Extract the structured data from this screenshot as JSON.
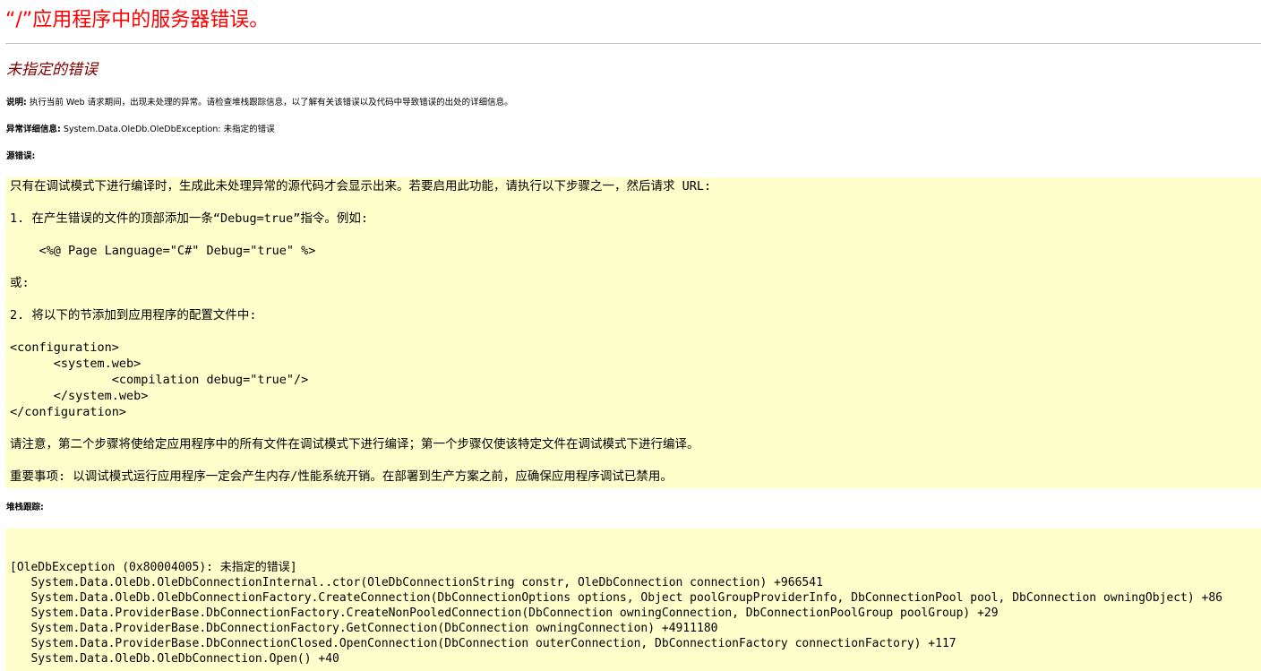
{
  "page": {
    "title": "“/”应用程序中的服务器错误。",
    "error_heading": "未指定的错误"
  },
  "description": {
    "label": "说明:",
    "text": " 执行当前 Web 请求期间，出现未处理的异常。请检查堆栈跟踪信息，以了解有关该错误以及代码中导致错误的出处的详细信息。"
  },
  "exception_details": {
    "label": "异常详细信息:",
    "text": " System.Data.OleDb.OleDbException: 未指定的错误"
  },
  "source_error": {
    "label": "源错误:",
    "lines": [
      "只有在调试模式下进行编译时，生成此未处理异常的源代码才会显示出来。若要启用此功能，请执行以下步骤之一，然后请求 URL:",
      "1. 在产生错误的文件的顶部添加一条“Debug=true”指令。例如:",
      "    <%@ Page Language=\"C#\" Debug=\"true\" %>",
      "或:",
      "2. 将以下的节添加到应用程序的配置文件中:",
      "<configuration>",
      "      <system.web>",
      "              <compilation debug=\"true\"/>",
      "      </system.web>",
      "</configuration>",
      "请注意，第二个步骤将使给定应用程序中的所有文件在调试模式下进行编译；第一个步骤仅使该特定文件在调试模式下进行编译。",
      "重要事项: 以调试模式运行应用程序一定会产生内存/性能系统开销。在部署到生产方案之前，应确保应用程序调试已禁用。"
    ]
  },
  "stack_trace": {
    "label": "堆栈跟踪:",
    "lines": [
      "[OleDbException (0x80004005): 未指定的错误]",
      "   System.Data.OleDb.OleDbConnectionInternal..ctor(OleDbConnectionString constr, OleDbConnection connection) +966541",
      "   System.Data.OleDb.OleDbConnectionFactory.CreateConnection(DbConnectionOptions options, Object poolGroupProviderInfo, DbConnectionPool pool, DbConnection owningObject) +86",
      "   System.Data.ProviderBase.DbConnectionFactory.CreateNonPooledConnection(DbConnection owningConnection, DbConnectionPoolGroup poolGroup) +29",
      "   System.Data.ProviderBase.DbConnectionFactory.GetConnection(DbConnection owningConnection) +4911180",
      "   System.Data.ProviderBase.DbConnectionClosed.OpenConnection(DbConnection outerConnection, DbConnectionFactory connectionFactory) +117",
      "   System.Data.OleDb.OleDbConnection.Open() +40"
    ]
  },
  "colors": {
    "title": "#ff0000",
    "heading": "#800000",
    "code_background": "#ffffcc",
    "rule": "#c0c0c0"
  }
}
